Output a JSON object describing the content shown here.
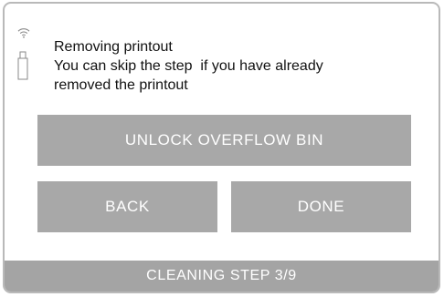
{
  "status_bar": {
    "icons": [
      "wifi-icon",
      "usb-drive-icon"
    ]
  },
  "message": {
    "line1": "Removing printout",
    "line2": "You can skip the step  if you have already",
    "line3": "removed the printout"
  },
  "buttons": {
    "unlock_label": "UNLOCK OVERFLOW BIN",
    "back_label": "BACK",
    "done_label": "DONE"
  },
  "footer": {
    "step_label": "CLEANING STEP 3/9"
  },
  "colors": {
    "button_bg": "#a8a8a8",
    "footer_bg": "#a4a4a4",
    "button_text": "#ffffff",
    "frame_border": "#b9b9b9"
  }
}
